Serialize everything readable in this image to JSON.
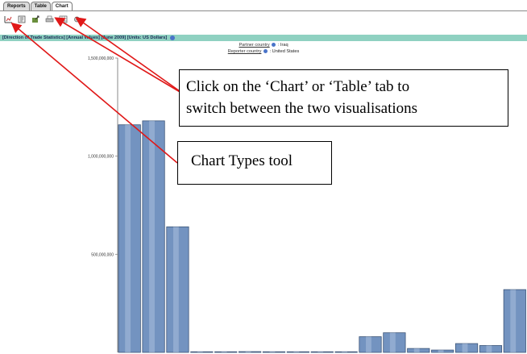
{
  "tabs": [
    {
      "label": "Reports",
      "active": false
    },
    {
      "label": "Table",
      "active": false
    },
    {
      "label": "Chart",
      "active": true
    }
  ],
  "toolbar": {
    "icons": [
      "chart-types-icon",
      "zoom-icon",
      "export-icon",
      "print-icon",
      "grid-icon",
      "settings-icon"
    ]
  },
  "infobar": {
    "text": "[Direction of Trade Statistics] [Annual values] [June 2009] [Units: US Dollars]"
  },
  "subtitles": {
    "partner_label": "Partner country",
    "partner_value": ": Iraq",
    "reporter_label": "Reporter country",
    "reporter_value": ": United States"
  },
  "annotations": {
    "tabs_line1": "Click on the ‘Chart’ or ‘Table’ tab to",
    "tabs_line2": "switch between the two visualisations",
    "tool": "Chart Types tool"
  },
  "colors": {
    "bar": "#7393c0",
    "bar_edge": "#3c5578",
    "infobar": "#8fd1c1",
    "arrow": "#e01818"
  },
  "chart_data": {
    "type": "bar",
    "ylim": [
      0,
      1500000000
    ],
    "yticks": [
      {
        "value": 1500000000,
        "label": "1,500,000,000"
      },
      {
        "value": 1000000000,
        "label": "1,000,000,000"
      },
      {
        "value": 500000000,
        "label": "500,000,000"
      }
    ],
    "values": [
      1160000000,
      1180000000,
      640000000,
      2000000,
      2000000,
      4000000,
      3000000,
      3000000,
      2000000,
      2000000,
      80000000,
      100000000,
      20000000,
      12000000,
      45000000,
      35000000,
      320000000
    ]
  }
}
